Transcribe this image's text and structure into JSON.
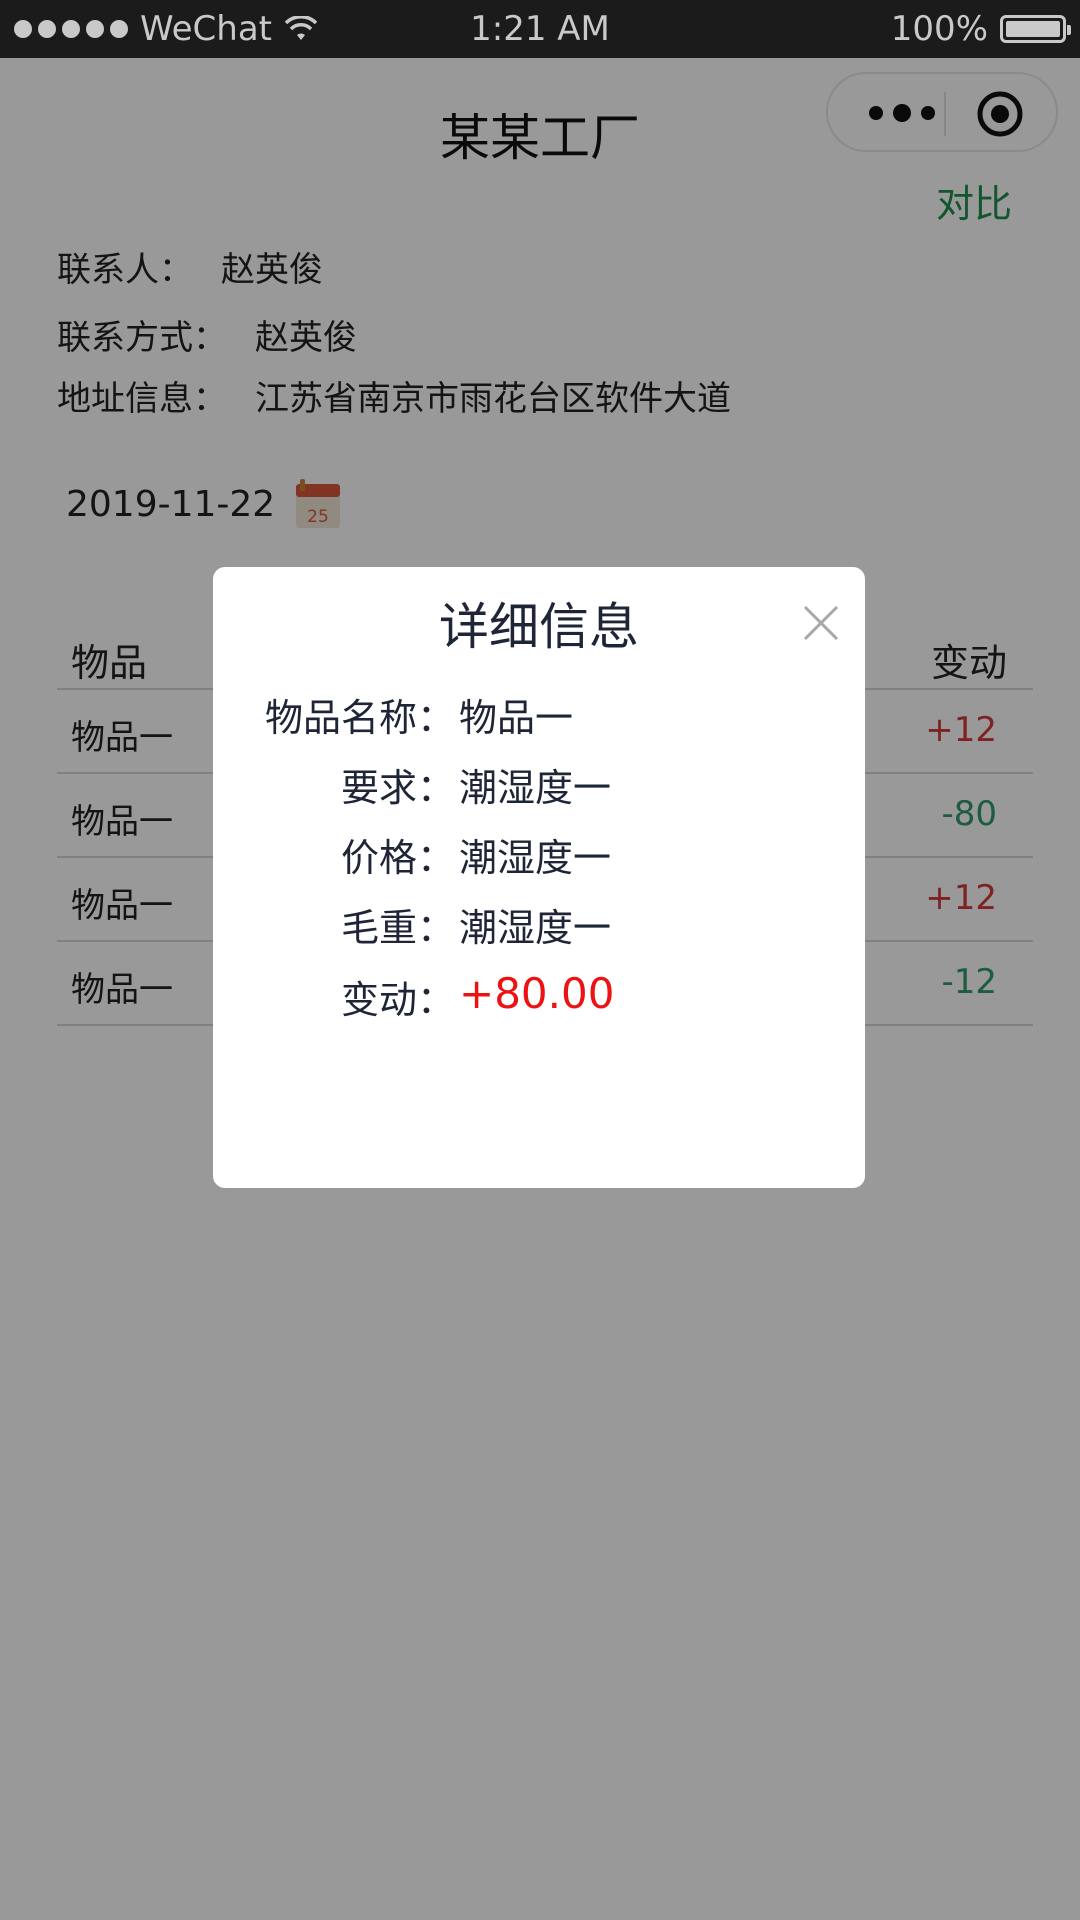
{
  "status_bar": {
    "carrier": "WeChat",
    "time": "1:21 AM",
    "battery": "100%",
    "battery_level": 1.0
  },
  "nav": {
    "title": "某某工厂",
    "more_icon": "more-dots-icon",
    "close_icon": "target-circle-icon"
  },
  "header": {
    "compare_link": "对比"
  },
  "info": {
    "contact_label": "联系人：",
    "contact_value": "赵英俊",
    "phone_label": "联系方式：",
    "phone_value": "赵英俊",
    "address_label": "地址信息：",
    "address_value": "江苏省南京市雨花台区软件大道"
  },
  "date_picker": {
    "date": "2019-11-22",
    "calendar_icon_text": "25"
  },
  "table": {
    "headers": [
      "物品",
      "变动"
    ],
    "rows": [
      {
        "item": "物品一",
        "change": "+12",
        "trend": "up"
      },
      {
        "item": "物品一",
        "change": "-80",
        "trend": "down"
      },
      {
        "item": "物品一",
        "change": "+12",
        "trend": "up"
      },
      {
        "item": "物品一",
        "change": "-12",
        "trend": "down"
      }
    ]
  },
  "modal": {
    "title": "详细信息",
    "fields": [
      {
        "label": "物品名称：",
        "value": "物品一"
      },
      {
        "label": "要求：",
        "value": "潮湿度一"
      },
      {
        "label": "价格：",
        "value": "潮湿度一"
      },
      {
        "label": "毛重：",
        "value": "潮湿度一"
      },
      {
        "label": "变动：",
        "value": "+80.00",
        "highlight": true
      }
    ]
  },
  "colors": {
    "accent_green": "#1f8f4e",
    "positive": "#d23b3b",
    "negative": "#2f9a6a",
    "highlight_red": "#ee1111"
  }
}
